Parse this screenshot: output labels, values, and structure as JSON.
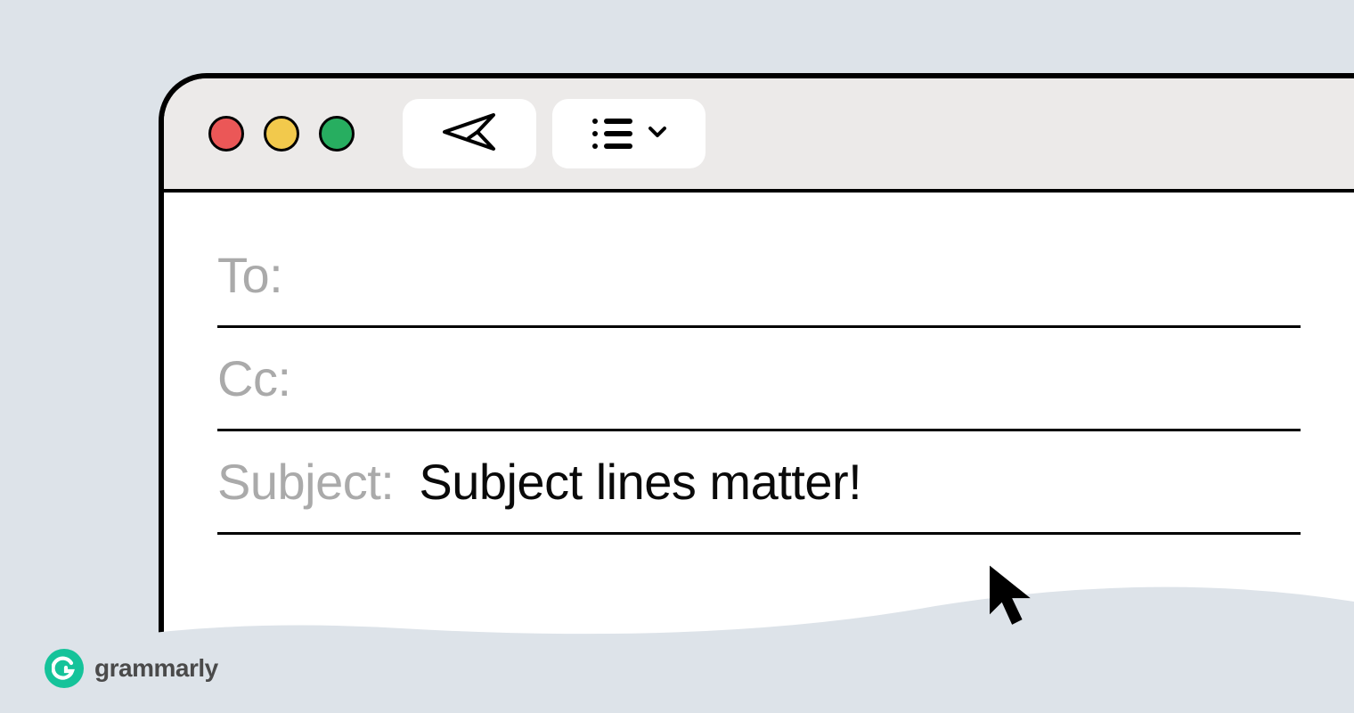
{
  "fields": {
    "to_label": "To:",
    "to_value": "",
    "cc_label": "Cc:",
    "cc_value": "",
    "subject_label": "Subject:",
    "subject_value": "Subject lines matter!"
  },
  "brand": {
    "name": "grammarly",
    "logo_letter": "G",
    "logo_color": "#15c39a"
  },
  "traffic_lights": {
    "red": "#eb5757",
    "yellow": "#f2c94c",
    "green": "#27ae60"
  }
}
